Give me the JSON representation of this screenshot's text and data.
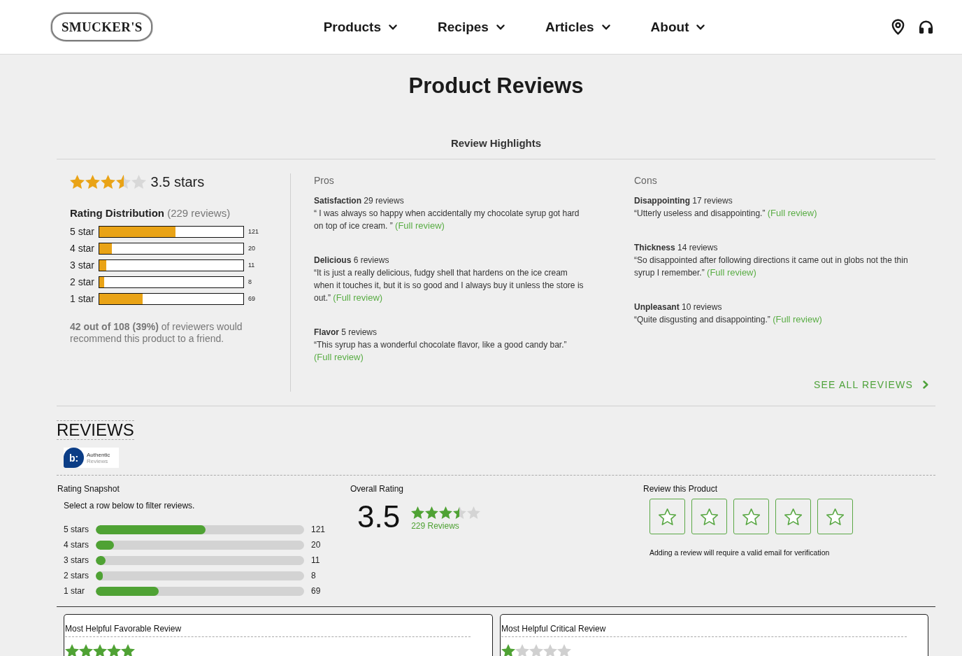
{
  "header": {
    "logo": "SMUCKER'S",
    "nav": [
      {
        "label": "Products"
      },
      {
        "label": "Recipes"
      },
      {
        "label": "Articles"
      },
      {
        "label": "About"
      }
    ]
  },
  "page_title": "Product Reviews",
  "highlights": {
    "heading": "Review Highlights",
    "summary": {
      "stars": 3.5,
      "rating_text": "3.5 stars",
      "distribution_title": "Rating Distribution",
      "distribution_count": "(229 reviews)",
      "bars": [
        {
          "label": "5 star",
          "level": 0.528,
          "count": "121"
        },
        {
          "label": "4 star",
          "level": 0.087,
          "count": "20"
        },
        {
          "label": "3 star",
          "level": 0.048,
          "count": "11"
        },
        {
          "label": "2 star",
          "level": 0.035,
          "count": "8"
        },
        {
          "label": "1 star",
          "level": 0.301,
          "count": "69"
        }
      ],
      "recommend": "**42 out of 108 (39%)** of reviewers would recommend this product to a friend."
    },
    "pros": {
      "heading": "Pros",
      "items": [
        {
          "topic": "Satisfaction",
          "count": "29 reviews",
          "quote": "“ I was always so happy when accidentally my chocolate syrup got hard on top of ice cream.  ”",
          "link": "(Full review)"
        },
        {
          "topic": "Delicious",
          "count": "6 reviews",
          "quote": "“It is just a really delicious, fudgy shell that hardens on the ice cream when it touches it, but it is so good and I always buy it unless the store is out.”",
          "link": "(Full review)"
        },
        {
          "topic": "Flavor",
          "count": "5 reviews",
          "quote": "“This syrup has a wonderful chocolate flavor, like a good candy bar.”",
          "link": "(Full review)"
        }
      ]
    },
    "cons": {
      "heading": "Cons",
      "items": [
        {
          "topic": "Disappointing",
          "count": "17 reviews",
          "quote": "“Utterly useless and disappointing.”",
          "link": "(Full review)"
        },
        {
          "topic": "Thickness",
          "count": "14 reviews",
          "quote": "“So disappointed after following directions it came out in globs not the thin syrup I remember.”",
          "link": "(Full review)"
        },
        {
          "topic": "Unpleasant",
          "count": "10 reviews",
          "quote": "“Quite disgusting and disappointing.”",
          "link": "(Full review)"
        }
      ]
    },
    "see_all": "SEE ALL REVIEWS"
  },
  "reviews": {
    "heading": "REVIEWS",
    "badge": {
      "mark": "b:",
      "line_1": "Authentic",
      "line_2": "Reviews"
    },
    "snapshot": {
      "title": "Rating Snapshot",
      "hint": "Select a row below to filter reviews.",
      "rows": [
        {
          "label": "5 stars",
          "level": 0.528,
          "count": "121"
        },
        {
          "label": "4 stars",
          "level": 0.087,
          "count": "20"
        },
        {
          "label": "3 stars",
          "level": 0.048,
          "count": "11"
        },
        {
          "label": "2 stars",
          "level": 0.035,
          "count": "8"
        },
        {
          "label": "1 star",
          "level": 0.301,
          "count": "69"
        }
      ]
    },
    "overall": {
      "title": "Overall Rating",
      "score": "3.5",
      "stars": 3.5,
      "count": "229 Reviews"
    },
    "write_review": {
      "title": "Review this Product",
      "star_buttons": [
        {
          "selected": false
        },
        {
          "selected": false
        },
        {
          "selected": false
        },
        {
          "selected": false
        },
        {
          "selected": false
        }
      ],
      "note": "Adding a review will require a valid email for verification"
    },
    "featured": [
      {
        "title": "Most Helpful Favorable Review",
        "stars": 5
      },
      {
        "title": "Most Helpful Critical Review",
        "stars": 1
      }
    ]
  }
}
